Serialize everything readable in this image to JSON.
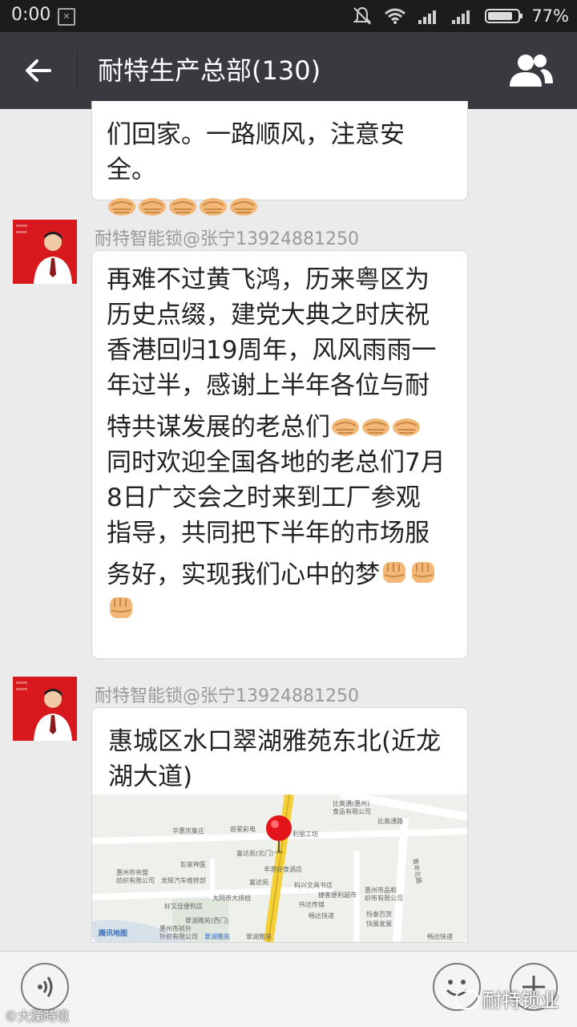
{
  "status": {
    "time": "0:00",
    "battery": "77%"
  },
  "header": {
    "title": "耐特生产总部(130)"
  },
  "messages": {
    "prev": {
      "line": "们回家。一路顺风，注意安全。"
    },
    "m1": {
      "sender": "耐特智能锁@张宁13924881250",
      "lines": [
        "再难不过黄飞鸿，历来粤区为",
        "历史点缀，建党大典之时庆祝",
        "香港回归19周年，风风雨雨一",
        "年过半，感谢上半年各位与耐",
        "特共谋发展的老总们",
        "同时欢迎全国各地的老总们7月",
        "8日广交会之时来到工厂参观",
        "指导，共同把下半年的市场服",
        "务好，实现我们心中的梦"
      ]
    },
    "m2": {
      "sender": "耐特智能锁@张宁13924881250",
      "address": [
        "惠城区水口翠湖雅苑东北(近龙",
        "湖大道)"
      ]
    }
  },
  "map_labels": {
    "l1": "比奥通(惠州)",
    "l2": "食品有限公司",
    "l3": "比奥通路",
    "l4": "华惠庆集庄",
    "l5": "容星彩电",
    "l6": "利丽工坊",
    "l7": "富达苑(北门)",
    "l8": "彭家神医",
    "l9": "惠州市帝盟",
    "l10": "纺织有限公司",
    "l11": "龙辉汽车维修部",
    "l12": "丰港好食酒店",
    "l13": "富达苑",
    "l14": "科兴文具书店",
    "l15": "惠州市品和",
    "l16": "织布有限公司",
    "l17": "青年北路",
    "l18": "大同市大排档",
    "l19": "好又佳便利店",
    "l20": "捷客便利超市",
    "l21": "伟达传媒",
    "l22": "恒泰百货",
    "l23": "翠湖雅苑(西门)",
    "l24": "惠州市祯升",
    "l25": "针织有限公司",
    "l26": "翠湖雅苑",
    "l27": "翠湖雅苑",
    "l28": "腾讯地图",
    "l29": "畅达快递",
    "l30": "快展发展",
    "l31": "畅达快递"
  },
  "watermark": {
    "right": "耐特锁业",
    "left": "大瀾時境"
  },
  "colors": {
    "titlebar": "#393a3f",
    "background": "#ebebeb",
    "avatar": "#d7191d",
    "pin": "#e3141a"
  },
  "icons": [
    "back-arrow-icon",
    "group-members-icon",
    "handshake-emoji",
    "fist-emoji",
    "voice-icon",
    "emoji-icon",
    "add-icon",
    "map-pin-icon"
  ]
}
